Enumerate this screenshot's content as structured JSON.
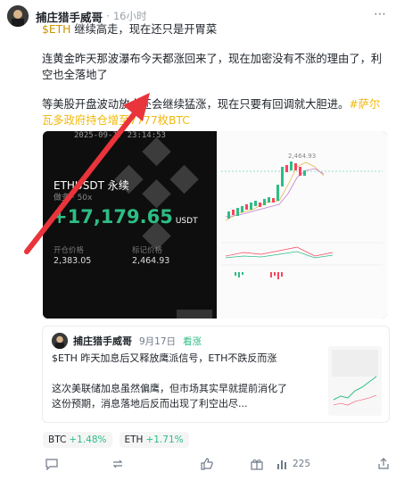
{
  "post": {
    "author": "捕庄猎手威哥",
    "time": "16小时",
    "more": "⋯",
    "line1_tag": "$ETH",
    "line1_text": " 继续高走，现在还只是开胃菜",
    "para2": "连黄金昨天那波瀑布今天都涨回来了，现在加密没有不涨的理由了，利空也全落地了",
    "para3_text": "等美股开盘波动放大还会继续猛涨，现在只要有回调就大胆进。",
    "para3_hashtag": "#萨尔瓦多政府持仓增至7777枚BTC"
  },
  "image": {
    "date_stamp": "2025-09-17 23:14:53",
    "symbol": "ETHUSDT 永续",
    "sub_label": "做多 · 50x",
    "pnl": "+17,179.65",
    "pnl_unit": "USDT",
    "entry_label": "开仓价格",
    "entry_value": "2,383.05",
    "mark_label": "标记价格",
    "mark_value": "2,464.93",
    "colors": {
      "up": "#2ebd85",
      "down": "#f6465d",
      "bg": "#0e0e0e"
    }
  },
  "quote": {
    "author": "捕庄猎手威哥",
    "date": "9月17日",
    "stance": "看涨",
    "text1": "$ETH 昨天加息后又释放鹰派信号，ETH不跌反而涨",
    "text2": "这次美联储加息虽然偏鹰，但市场其实早就提前消化了这份预期，消息落地后反而出现了利空出尽..."
  },
  "tickers": [
    {
      "symbol": "BTC",
      "change": "+1.48%"
    },
    {
      "symbol": "ETH",
      "change": "+1.71%"
    }
  ],
  "actions": {
    "reply_icon": "comment-icon",
    "repost_icon": "repost-icon",
    "like_icon": "thumbs-up-icon",
    "tip_icon": "gift-icon",
    "views_icon": "bar-chart-icon",
    "views": "225",
    "share_icon": "share-icon"
  }
}
